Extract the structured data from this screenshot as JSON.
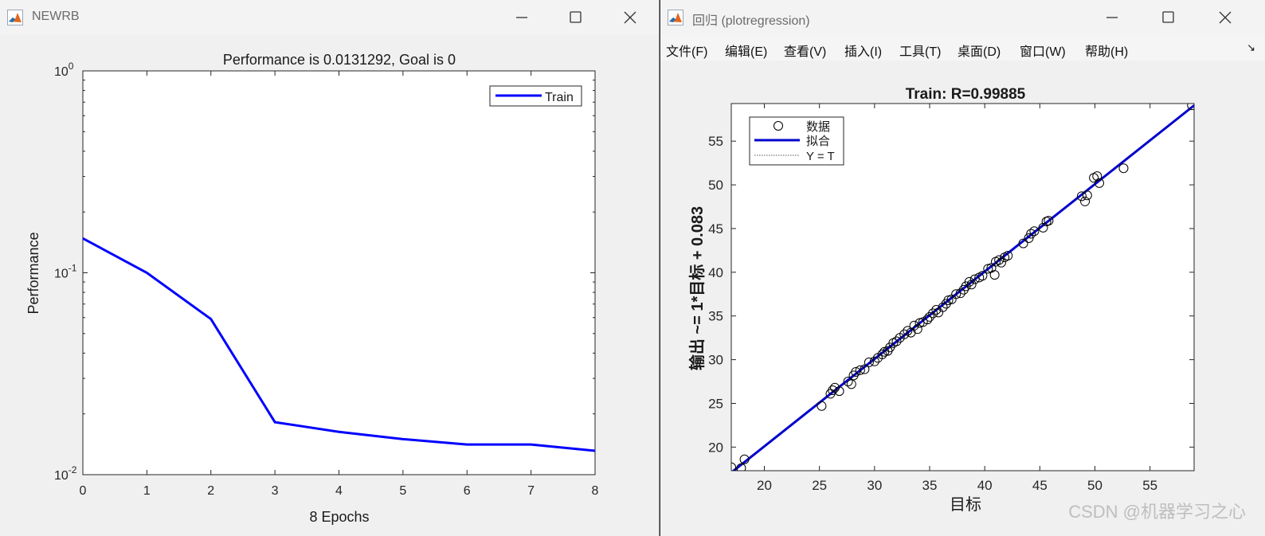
{
  "window1": {
    "title": "NEWRB",
    "chart_data": {
      "type": "line",
      "title": "Performance is 0.0131292, Goal is 0",
      "xlabel": "8 Epochs",
      "ylabel": "Performance",
      "yscale": "log",
      "xlim": [
        0,
        8
      ],
      "ylim": [
        0.01,
        1
      ],
      "xticks": [
        "0",
        "1",
        "2",
        "3",
        "4",
        "5",
        "6",
        "7",
        "8"
      ],
      "yticks": [
        "10^-2",
        "10^-1",
        "10^0"
      ],
      "legend_position": "top-right",
      "grid": false,
      "series": [
        {
          "name": "Train",
          "color": "#0000ff",
          "x": [
            0,
            1,
            2,
            3,
            4,
            5,
            6,
            7,
            8
          ],
          "y": [
            0.148,
            0.1,
            0.059,
            0.0182,
            0.0163,
            0.015,
            0.0141,
            0.0141,
            0.0131292
          ]
        }
      ]
    }
  },
  "window2": {
    "title": "回归 (plotregression)",
    "menu": [
      "文件(F)",
      "编辑(E)",
      "查看(V)",
      "插入(I)",
      "工具(T)",
      "桌面(D)",
      "窗口(W)",
      "帮助(H)"
    ],
    "chart_data": {
      "type": "scatter",
      "title": "Train: R=0.99885",
      "xlabel": "目标",
      "ylabel": "输出 ~= 1*目标 + 0.083",
      "xlim": [
        17,
        59
      ],
      "ylim": [
        17.3,
        59.3
      ],
      "xticks": [
        "20",
        "25",
        "30",
        "35",
        "40",
        "45",
        "50",
        "55"
      ],
      "yticks": [
        "20",
        "25",
        "30",
        "35",
        "40",
        "45",
        "50",
        "55"
      ],
      "legend_position": "top-left",
      "grid": false,
      "legend": [
        "数据",
        "拟合",
        "Y = T"
      ],
      "fit": {
        "slope": 1,
        "intercept": 0.083,
        "color": "#0000cc"
      },
      "points": [
        [
          17.0,
          17.7
        ],
        [
          17.9,
          17.6
        ],
        [
          18.2,
          18.6
        ],
        [
          25.2,
          24.7
        ],
        [
          26.0,
          26.1
        ],
        [
          26.2,
          26.5
        ],
        [
          26.4,
          26.8
        ],
        [
          26.8,
          26.4
        ],
        [
          27.6,
          27.5
        ],
        [
          27.9,
          27.2
        ],
        [
          28.1,
          28.2
        ],
        [
          28.3,
          28.6
        ],
        [
          28.7,
          28.8
        ],
        [
          29.1,
          28.9
        ],
        [
          29.5,
          29.7
        ],
        [
          30.0,
          29.8
        ],
        [
          30.3,
          30.2
        ],
        [
          30.7,
          30.6
        ],
        [
          30.9,
          30.9
        ],
        [
          31.2,
          31.0
        ],
        [
          31.4,
          31.4
        ],
        [
          31.7,
          31.9
        ],
        [
          32.0,
          32.1
        ],
        [
          32.3,
          32.5
        ],
        [
          32.7,
          32.9
        ],
        [
          33.0,
          33.3
        ],
        [
          33.3,
          33.1
        ],
        [
          33.6,
          33.9
        ],
        [
          33.9,
          33.5
        ],
        [
          34.1,
          34.2
        ],
        [
          34.4,
          34.3
        ],
        [
          34.8,
          34.6
        ],
        [
          35.0,
          34.9
        ],
        [
          35.3,
          35.3
        ],
        [
          35.6,
          35.7
        ],
        [
          35.8,
          35.4
        ],
        [
          36.2,
          36.0
        ],
        [
          36.5,
          36.4
        ],
        [
          36.7,
          36.8
        ],
        [
          37.0,
          36.9
        ],
        [
          37.4,
          37.5
        ],
        [
          37.8,
          37.6
        ],
        [
          38.1,
          38.0
        ],
        [
          38.3,
          38.4
        ],
        [
          38.6,
          38.9
        ],
        [
          38.8,
          38.6
        ],
        [
          39.1,
          39.2
        ],
        [
          39.5,
          39.4
        ],
        [
          39.8,
          39.6
        ],
        [
          40.3,
          40.4
        ],
        [
          40.6,
          40.5
        ],
        [
          40.9,
          39.7
        ],
        [
          41.0,
          41.2
        ],
        [
          41.3,
          41.4
        ],
        [
          41.5,
          41.1
        ],
        [
          41.8,
          41.7
        ],
        [
          42.1,
          41.9
        ],
        [
          43.5,
          43.3
        ],
        [
          44.0,
          43.9
        ],
        [
          44.2,
          44.4
        ],
        [
          44.5,
          44.7
        ],
        [
          45.3,
          45.1
        ],
        [
          45.6,
          45.8
        ],
        [
          45.8,
          45.9
        ],
        [
          48.8,
          48.7
        ],
        [
          49.1,
          48.1
        ],
        [
          49.3,
          48.8
        ],
        [
          49.9,
          50.8
        ],
        [
          50.2,
          51.0
        ],
        [
          50.4,
          50.2
        ],
        [
          52.6,
          51.9
        ],
        [
          58.8,
          59.1
        ]
      ]
    }
  },
  "watermark": "CSDN @机器学习之心"
}
